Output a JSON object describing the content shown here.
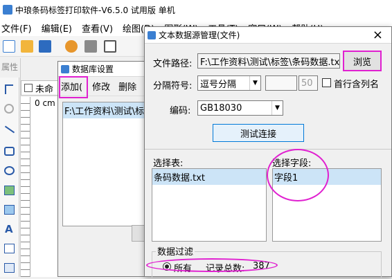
{
  "app": {
    "title": "中琅条码标签打印软件-V6.5.0 试用版 单机",
    "menu": [
      "文件(F)",
      "编辑(E)",
      "查看(V)",
      "绘图(D)",
      "图形(W)",
      "工具(T)",
      "窗口(W)",
      "帮助(H)"
    ],
    "panel_tab": "属性",
    "doc_tab": "未命",
    "ruler_label": "0 cm"
  },
  "db_dialog": {
    "title": "数据库设置",
    "toolbar": [
      "添加(",
      "修改",
      "删除"
    ],
    "list_items": [
      "F:\\工作资料\\测试\\标"
    ]
  },
  "text_dialog": {
    "title": "文本数据源管理(文件)",
    "close": "×",
    "path_label": "文件路径:",
    "path_value": "F:\\工作资料\\测试\\标签\\条码数据.txt",
    "browse": "浏览",
    "sep_label": "分隔符号:",
    "sep_value": "逗号分隔",
    "sep_num": "50",
    "first_row_label": "首行含列名",
    "enc_label": "编码:",
    "enc_value": "GB18030",
    "test_button": "测试连接",
    "tables_label": "选择表:",
    "tables": [
      "条码数据.txt"
    ],
    "fields_label": "选择字段:",
    "fields": [
      "字段1"
    ],
    "filter_label": "数据过滤",
    "radio_all": "所有",
    "record_label": "记录总数:",
    "record_count": "387"
  },
  "colors": {
    "accent": "#e020d0",
    "selection": "#cce4f7"
  }
}
